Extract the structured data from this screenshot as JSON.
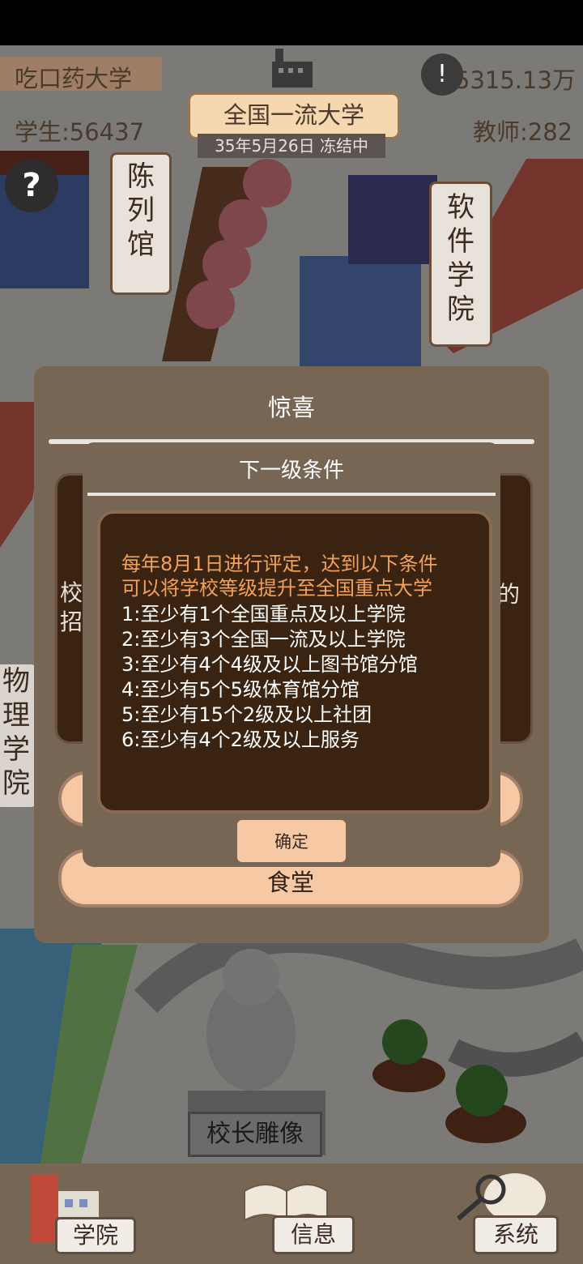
{
  "header": {
    "university_name": "吃口药大学",
    "money": "5315.13万",
    "level_title": "全国一流大学",
    "date_status": "35年5月26日 冻结中",
    "students": "学生:56437",
    "teachers": "教师:282",
    "help_icon": "?",
    "alert_icon": "!"
  },
  "map_labels": {
    "exhibition_hall": "陈列馆",
    "software_college": "软件学院",
    "physics_college": "物理学院",
    "statue": "校长雕像"
  },
  "outer_dialog": {
    "title": "惊喜",
    "left_text": "校招",
    "right_text": "的",
    "button_label": "食堂"
  },
  "inner_dialog": {
    "title": "下一级条件",
    "intro_lines": [
      "每年8月1日进行评定，达到以下条件",
      "可以将学校等级提升至全国重点大学"
    ],
    "conditions": [
      "1:至少有1个全国重点及以上学院",
      "2:至少有3个全国一流及以上学院",
      "3:至少有4个4级及以上图书馆分馆",
      "4:至少有5个5级体育馆分馆",
      "5:至少有15个2级及以上社团",
      "6:至少有4个2级及以上服务"
    ],
    "confirm_label": "确定"
  },
  "bottom_nav": {
    "college": "学院",
    "info": "信息",
    "system": "系统"
  },
  "colors": {
    "dialog_bg": "#786655",
    "card_bg": "#3a2310",
    "highlight_text": "#f2a25a",
    "button_bg": "#f6c9a4"
  }
}
